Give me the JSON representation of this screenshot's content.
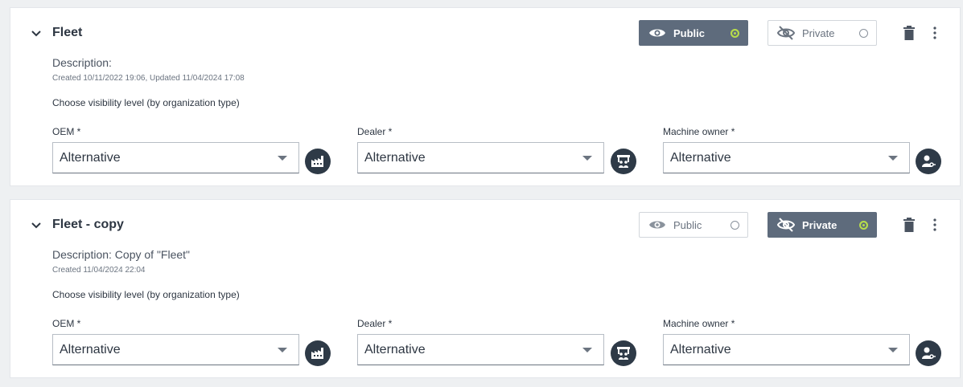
{
  "cards": [
    {
      "title": "Fleet",
      "description": "Description:",
      "created": "Created 10/11/2022 19:06, Updated 11/04/2024 17:08",
      "choose_label": "Choose visibility level (by organization type)",
      "visibility_selected": "Public",
      "public_label": "Public",
      "private_label": "Private",
      "fields": [
        {
          "label": "OEM *",
          "value": "Alternative",
          "icon": "factory-icon"
        },
        {
          "label": "Dealer *",
          "value": "Alternative",
          "icon": "dealer-icon"
        },
        {
          "label": "Machine owner *",
          "value": "Alternative",
          "icon": "person-key-icon"
        }
      ]
    },
    {
      "title": "Fleet - copy",
      "description": "Description: Copy of \"Fleet\"",
      "created": "Created 11/04/2024 22:04",
      "choose_label": "Choose visibility level (by organization type)",
      "visibility_selected": "Private",
      "public_label": "Public",
      "private_label": "Private",
      "fields": [
        {
          "label": "OEM *",
          "value": "Alternative",
          "icon": "factory-icon"
        },
        {
          "label": "Dealer *",
          "value": "Alternative",
          "icon": "dealer-icon"
        },
        {
          "label": "Machine owner *",
          "value": "Alternative",
          "icon": "person-key-icon"
        }
      ]
    }
  ],
  "colors": {
    "active_button": "#5e6b7c",
    "active_radio": "#b7dd4b",
    "org_icon_bg": "#2e3a47",
    "page_bg": "#eef0f2"
  }
}
